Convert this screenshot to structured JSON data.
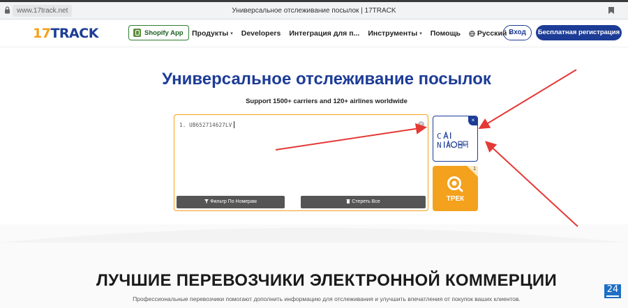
{
  "browser": {
    "url": "www.17track.net",
    "title": "Универсальное отслеживание посылок | 17TRACK"
  },
  "nav": {
    "logo_num": "17",
    "logo_text": "TRACK",
    "shopify_label": "Shopify App",
    "menu": [
      {
        "label": "Продукты",
        "caret": "▾"
      },
      {
        "label": "Developers",
        "caret": ""
      },
      {
        "label": "Интеграция для п...",
        "caret": ""
      },
      {
        "label": "Инструменты",
        "caret": "▾"
      },
      {
        "label": "Помощь",
        "caret": ""
      },
      {
        "label": "Русский",
        "caret": "▾"
      }
    ],
    "login_label": "Вход",
    "register_label": "Бесплатная регистрация"
  },
  "hero": {
    "title": "Универсальное отслеживание посылок",
    "subtitle": "Support 1500+ carriers and 120+ airlines worldwide",
    "input_value": "1. UB652714627LV",
    "filter_label": "Фильтр По Номерам",
    "erase_label": "Стереть Все",
    "track_label": "ТРЕК",
    "track_count": "1",
    "carrier_icon": "cainiao-logo"
  },
  "section": {
    "title": "ЛУЧШИЕ ПЕРЕВОЗЧИКИ ЭЛЕКТРОННОЙ КОММЕРЦИИ",
    "subtitle": "Профессиональные перевозчики помогают дополнить информацию для отслеживания и улучшить впечатления от покупок ваших клиентов."
  },
  "widget": {
    "label": "24"
  },
  "colors": {
    "brand_blue": "#1d3c96",
    "accent_orange": "#f4a11e",
    "annotation_red": "#e53935"
  }
}
